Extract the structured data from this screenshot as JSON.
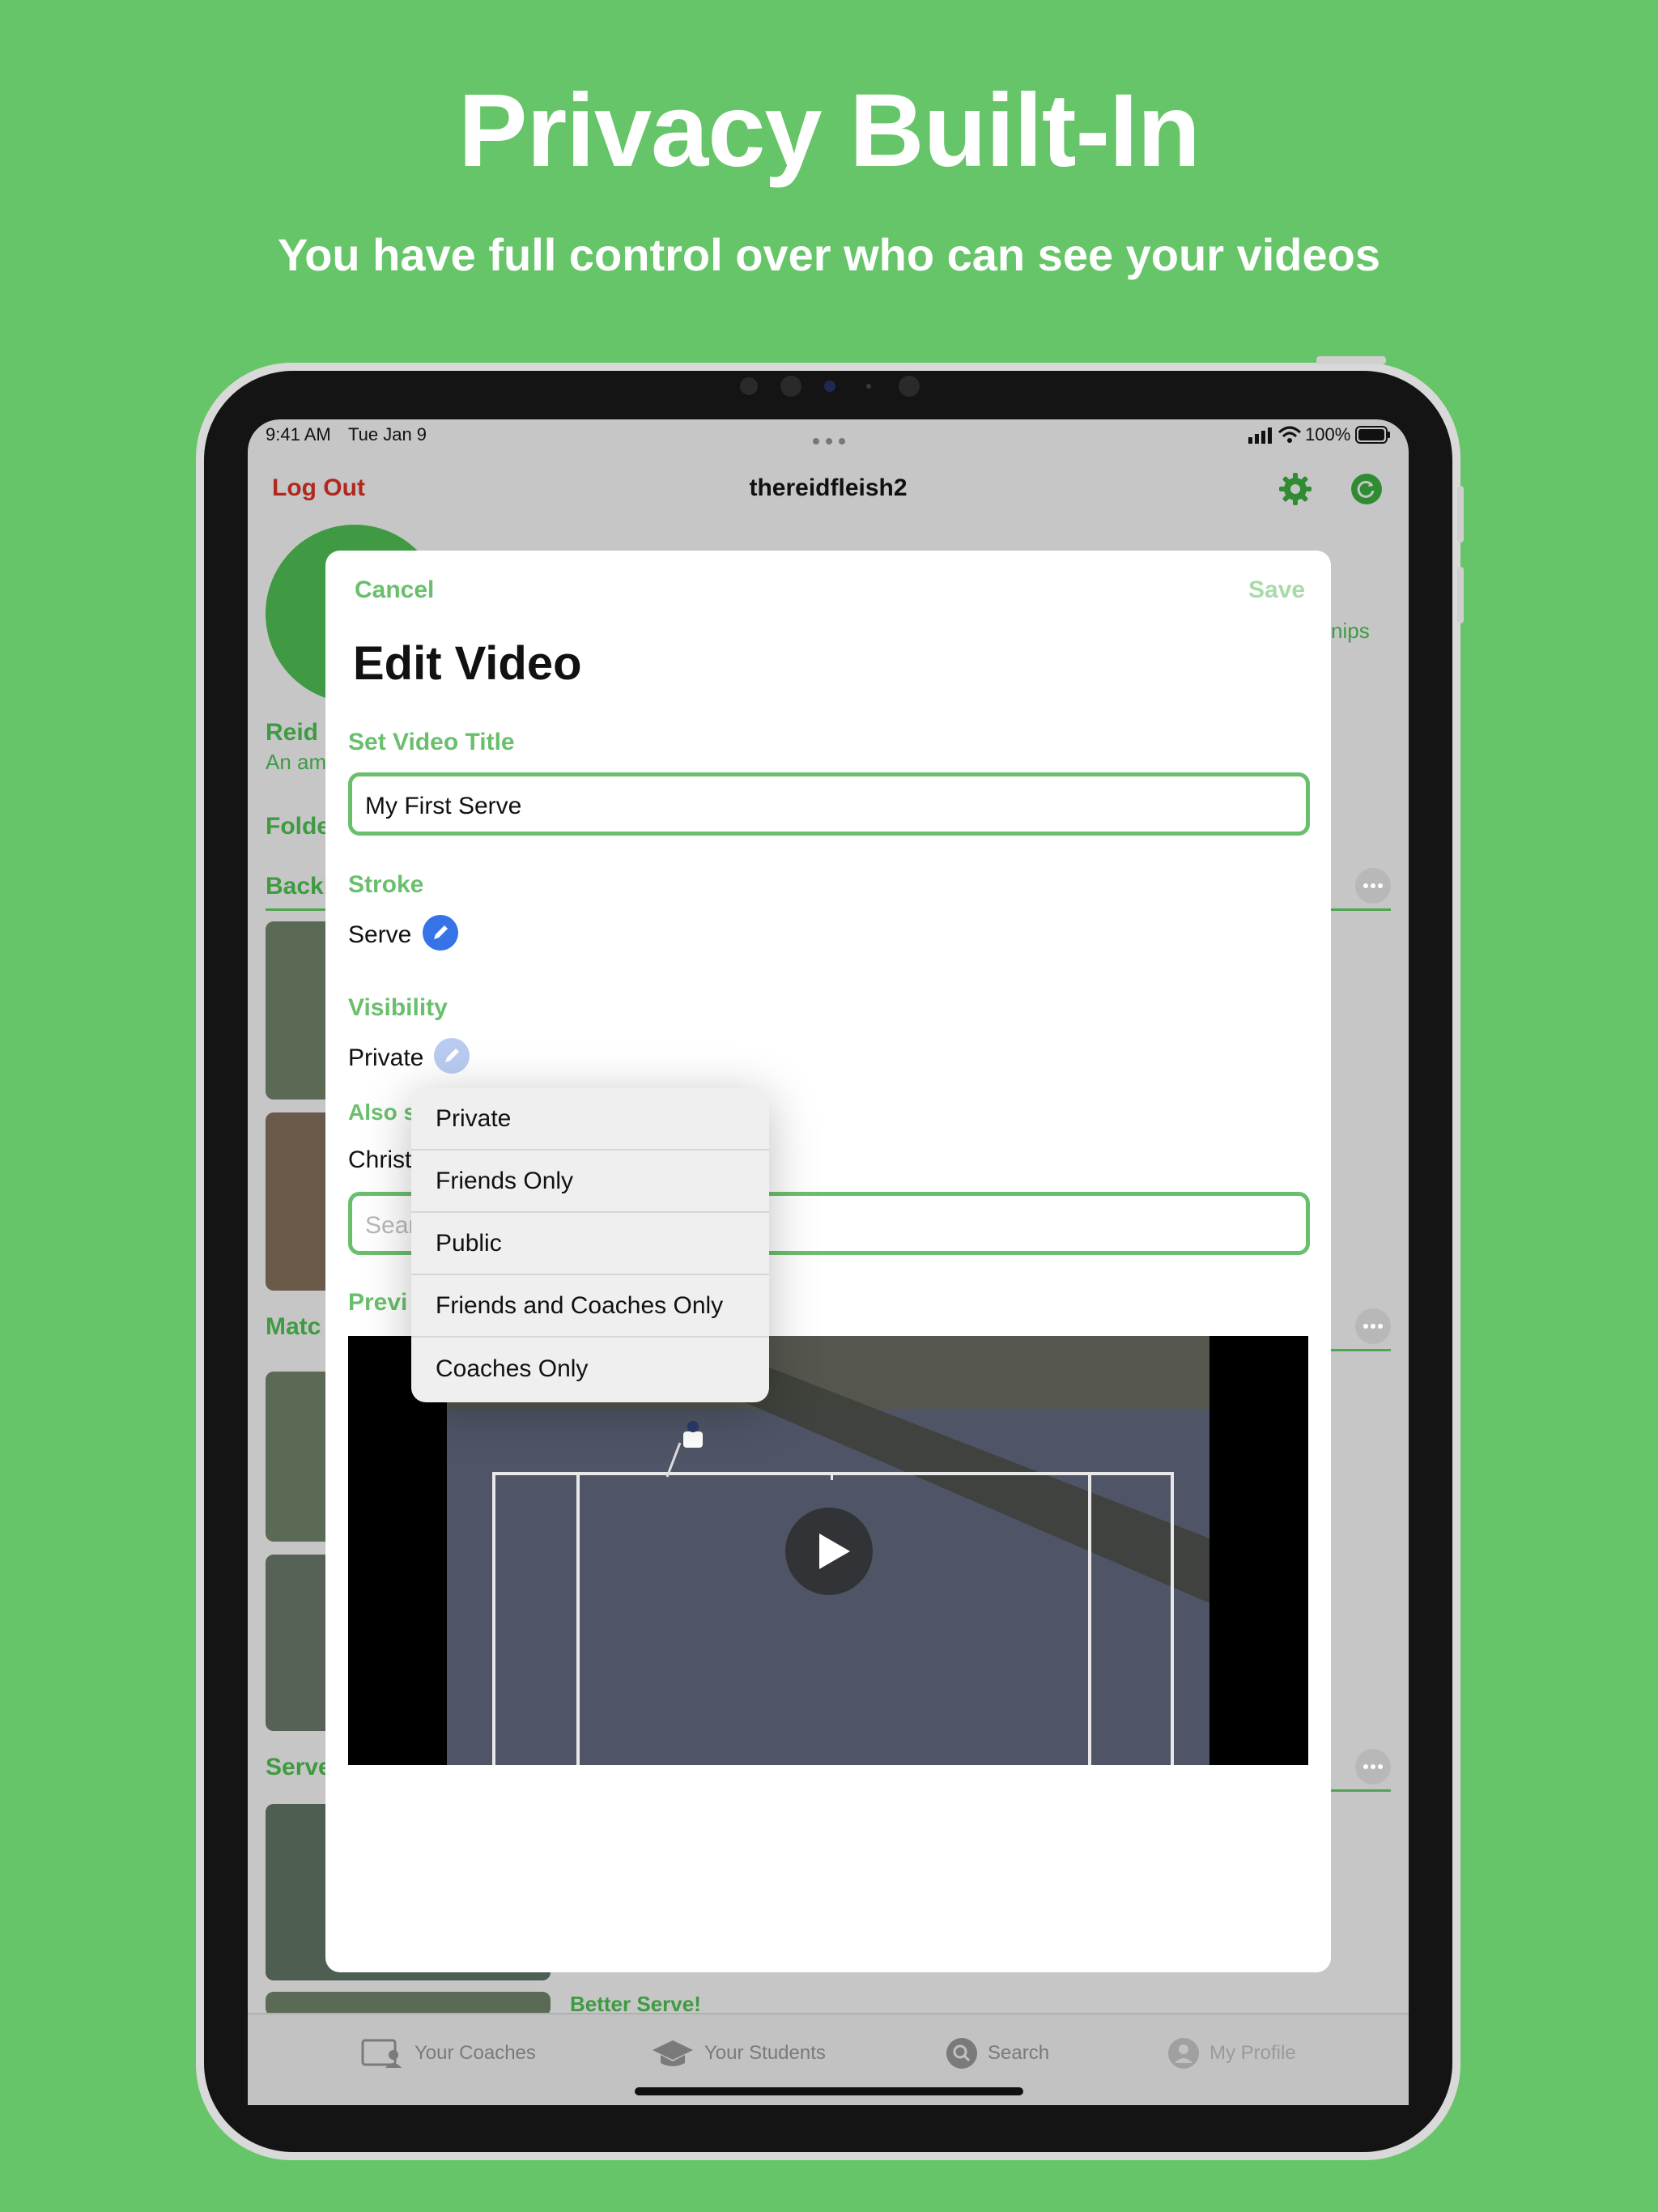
{
  "headline": "Privacy Built-In",
  "subline": "You have full control over who can see your videos",
  "status_bar": {
    "time": "9:41 AM",
    "date": "Tue Jan 9",
    "battery": "100%"
  },
  "nav": {
    "logout": "Log Out",
    "username": "thereidfleish2"
  },
  "background": {
    "profile_name": "Reid",
    "profile_bio": "An am",
    "side_text": "nips",
    "folders_label": "Folde",
    "section1": "Backh",
    "section2": "Matc",
    "section3": "Serve",
    "bottom_item": "Better Serve!"
  },
  "modal": {
    "cancel": "Cancel",
    "save": "Save",
    "title": "Edit Video",
    "title_label": "Set Video Title",
    "title_value": "My First Serve",
    "stroke_label": "Stroke",
    "stroke_value": "Serve",
    "visibility_label": "Visibility",
    "visibility_value": "Private",
    "also_share_label": "Also s",
    "also_share_value": "Christ",
    "search_placeholder": "Sear",
    "preview_label": "Previ"
  },
  "visibility_menu": [
    "Private",
    "Friends Only",
    "Public",
    "Friends and Coaches Only",
    "Coaches Only"
  ],
  "tabs": [
    {
      "label": "Your Coaches",
      "icon": "coaches-icon"
    },
    {
      "label": "Your Students",
      "icon": "graduation-cap-icon"
    },
    {
      "label": "Search",
      "icon": "search-icon"
    },
    {
      "label": "My Profile",
      "icon": "profile-icon"
    }
  ],
  "colors": {
    "brand_green": "#66c568",
    "accent_green": "#6abf6c",
    "logout_red": "#b2281f",
    "pencil_blue": "#3573e6"
  }
}
